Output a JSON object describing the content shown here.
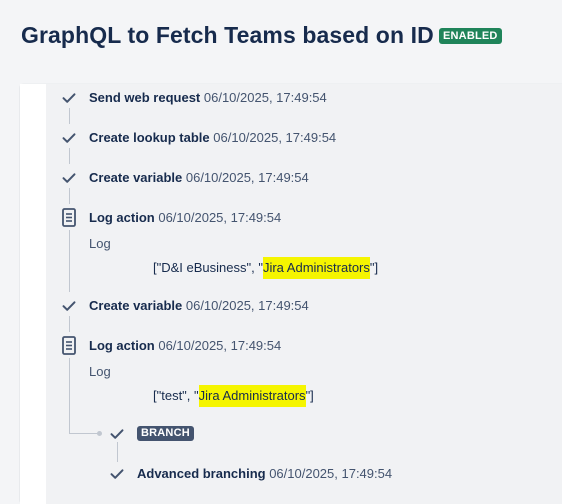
{
  "header": {
    "title": "GraphQL to Fetch Teams based on ID",
    "status_badge": "ENABLED",
    "status_color": "#1f845a"
  },
  "steps": [
    {
      "icon": "check-icon",
      "name": "Send web request",
      "timestamp": "06/10/2025, 17:49:54"
    },
    {
      "icon": "check-icon",
      "name": "Create lookup table",
      "timestamp": "06/10/2025, 17:49:54"
    },
    {
      "icon": "check-icon",
      "name": "Create variable",
      "timestamp": "06/10/2025, 17:49:54"
    },
    {
      "icon": "document-icon",
      "name": "Log action",
      "timestamp": "06/10/2025, 17:49:54",
      "sub_label": "Log",
      "log_value": {
        "prefix": "[\"D&I eBusiness\", \"",
        "highlight": "Jira Administrators",
        "suffix": "\"]"
      }
    },
    {
      "icon": "check-icon",
      "name": "Create variable",
      "timestamp": "06/10/2025, 17:49:54"
    },
    {
      "icon": "document-icon",
      "name": "Log action",
      "timestamp": "06/10/2025, 17:49:54",
      "sub_label": "Log",
      "log_value": {
        "prefix": "[\"test\", \"",
        "highlight": "Jira Administrators",
        "suffix": "\"]"
      }
    }
  ],
  "branch": {
    "badge": "BRANCH",
    "child": {
      "icon": "check-icon",
      "name": "Advanced branching",
      "timestamp": "06/10/2025, 17:49:54"
    }
  },
  "colors": {
    "highlight": "#f5f500",
    "branch_badge": "#44546f"
  }
}
